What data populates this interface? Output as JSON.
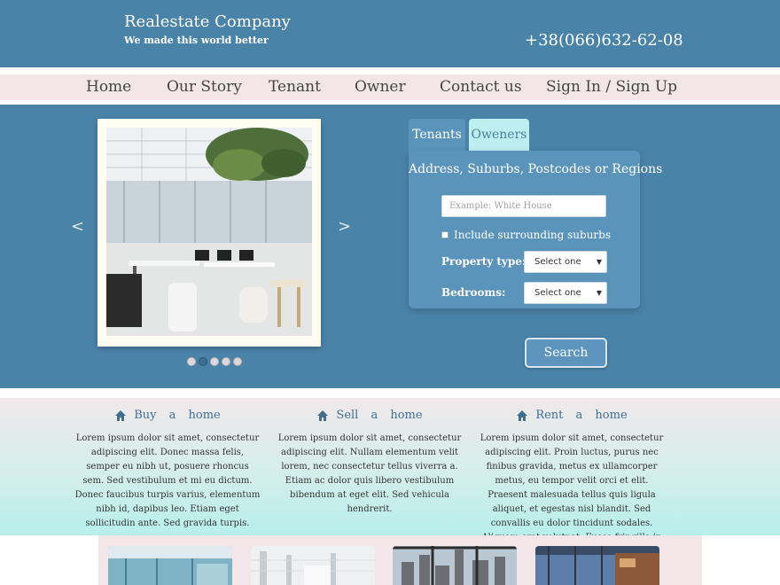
{
  "header": {
    "brand_name": "Realestate Company",
    "tagline": "We made this world better",
    "phone": "+38(066)632-62-08"
  },
  "nav": {
    "items": [
      {
        "label": "Home"
      },
      {
        "label": "Our Story"
      },
      {
        "label": "Tenant"
      },
      {
        "label": "Owner"
      },
      {
        "label": "Contact us"
      },
      {
        "label": "Sign In / Sign Up"
      }
    ]
  },
  "slider": {
    "prev": "<",
    "next": ">",
    "slide_count": 5,
    "active_slide": 2
  },
  "search": {
    "tabs": [
      {
        "label": "Tenants"
      },
      {
        "label": "Oweners"
      }
    ],
    "title": "Address, Suburbs, Postcodes or Regions",
    "placeholder": "Example: White House",
    "checkbox_label": "Include surrounding suburbs",
    "property_type_label": "Property type:",
    "property_type_value": "Select one",
    "bedrooms_label": "Bedrooms:",
    "bedrooms_value": "Select one",
    "button_label": "Search"
  },
  "features": [
    {
      "title": "Buy a home",
      "icon": "home-icon",
      "text": "Lorem ipsum dolor sit amet, consectetur adipiscing elit. Donec massa felis, semper eu nibh ut, posuere rhoncus sem. Sed vestibulum et mi eu dictum. Donec faucibus turpis varius, elementum nibh id, dapibus leo. Etiam eget sollicitudin ante. Sed gravida turpis."
    },
    {
      "title": "Sell a home",
      "icon": "home-icon",
      "text": "Lorem ipsum dolor sit amet, consectetur adipiscing elit. Nullam elementum velit lorem, nec consectetur tellus viverra a. Etiam ac dolor quis libero vestibulum bibendum at eget elit. Sed vehicula hendrerit."
    },
    {
      "title": "Rent a home",
      "icon": "home-icon",
      "text": "Lorem ipsum dolor sit amet, consectetur adipiscing elit. Proin luctus, purus nec finibus gravida, metus ex ullamcorper metus, eu tempor velit orci et elit. Praesent malesuada tellus quis ligula aliquet, et egestas nisl blandit. Sed convallis eu dolor tincidunt sodales. Aliquam erat volutpat. Fusce fringilla in augue id sollicitudin."
    }
  ],
  "colors": {
    "primary": "#4a83a8",
    "nav_bg": "#f3e6e8",
    "panel": "#5b94bb",
    "tab_inactive": "#bdeef0",
    "link": "#3e6f8f"
  }
}
